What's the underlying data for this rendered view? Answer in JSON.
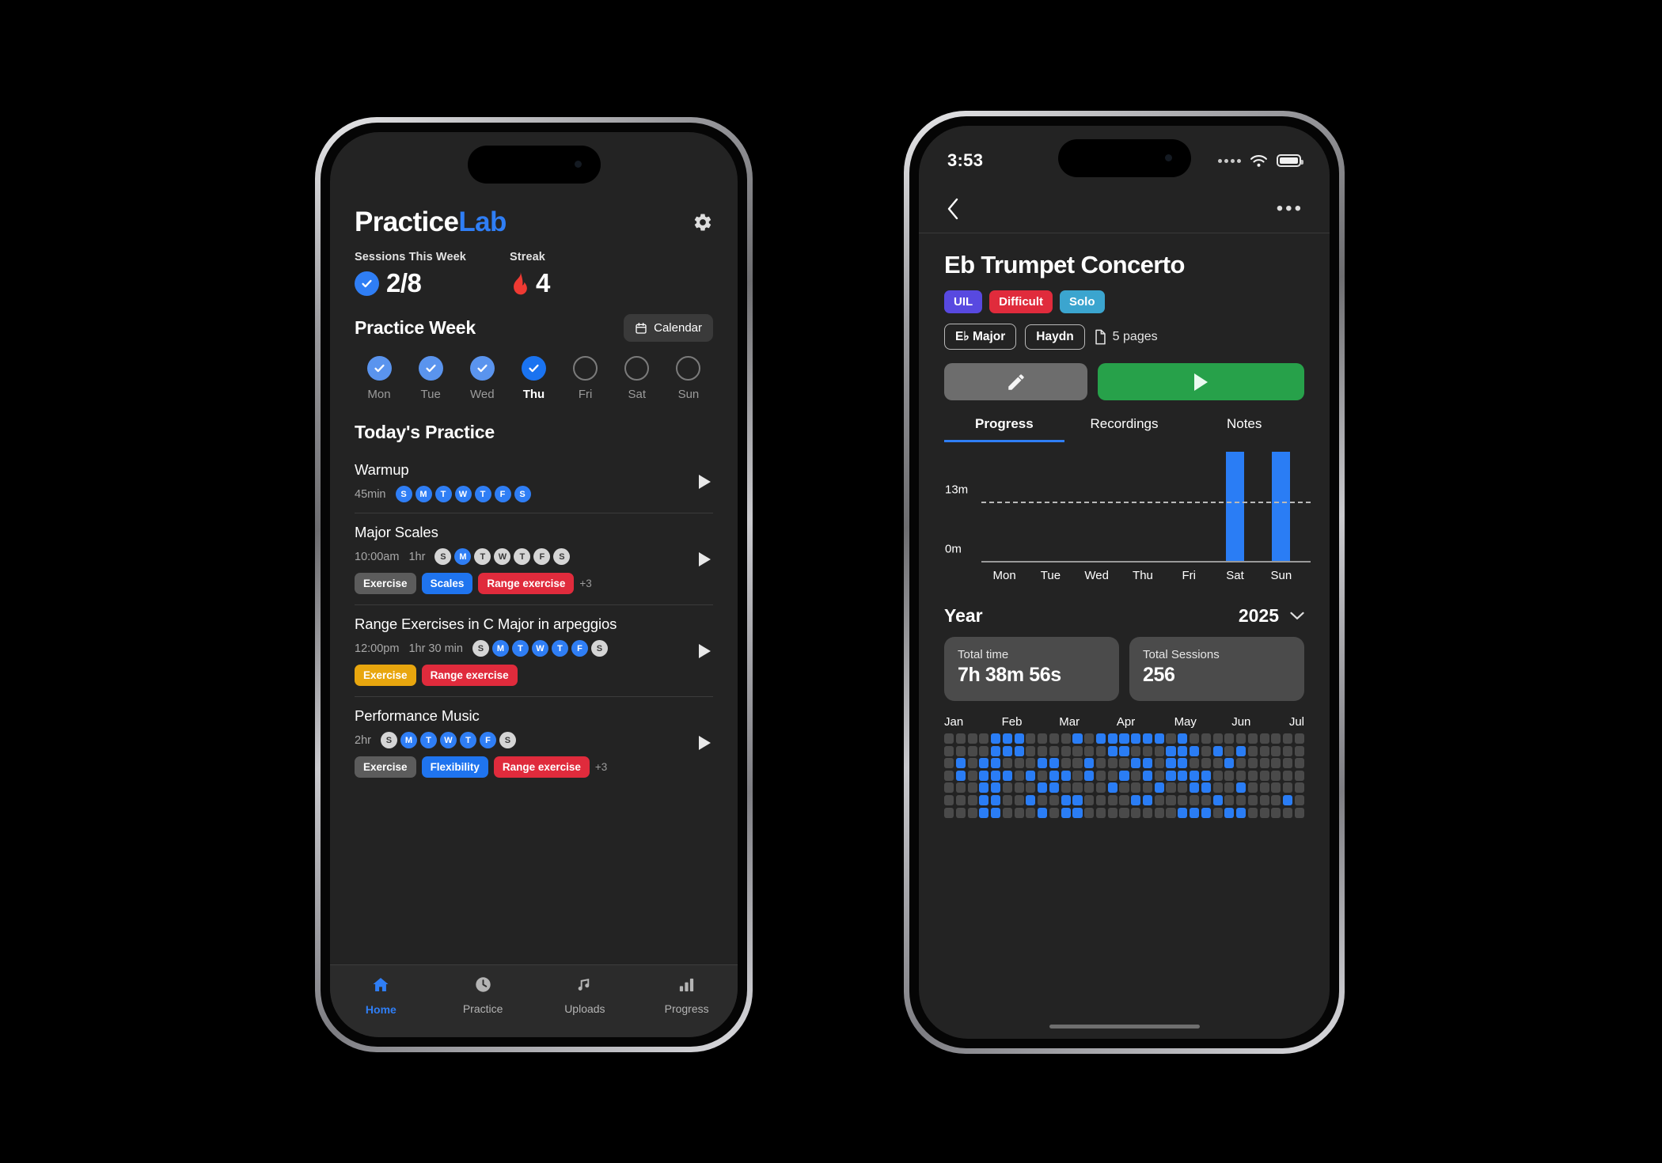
{
  "left_phone": {
    "brand": {
      "part1": "Practice",
      "part2": "Lab"
    },
    "settings_icon": "gear-icon",
    "stats": [
      {
        "label": "Sessions This Week",
        "value": "2/8",
        "icon": "check-circle-icon"
      },
      {
        "label": "Streak",
        "value": "4",
        "icon": "flame-icon"
      }
    ],
    "practice_week": {
      "title": "Practice Week",
      "calendar_button": "Calendar",
      "days": [
        {
          "name": "Mon",
          "state": "done"
        },
        {
          "name": "Tue",
          "state": "done"
        },
        {
          "name": "Wed",
          "state": "done"
        },
        {
          "name": "Thu",
          "state": "today"
        },
        {
          "name": "Fri",
          "state": "empty"
        },
        {
          "name": "Sat",
          "state": "empty"
        },
        {
          "name": "Sun",
          "state": "empty"
        }
      ]
    },
    "today_title": "Today's Practice",
    "tasks": [
      {
        "name": "Warmup",
        "time": "",
        "duration": "45min",
        "days": [
          {
            "letter": "S",
            "on": true
          },
          {
            "letter": "M",
            "on": true
          },
          {
            "letter": "T",
            "on": true
          },
          {
            "letter": "W",
            "on": true
          },
          {
            "letter": "T",
            "on": true
          },
          {
            "letter": "F",
            "on": true
          },
          {
            "letter": "S",
            "on": true
          }
        ],
        "tags": [],
        "more": ""
      },
      {
        "name": "Major Scales",
        "time": "10:00am",
        "duration": "1hr",
        "days": [
          {
            "letter": "S",
            "on": false
          },
          {
            "letter": "M",
            "on": true
          },
          {
            "letter": "T",
            "on": false
          },
          {
            "letter": "W",
            "on": false
          },
          {
            "letter": "T",
            "on": false
          },
          {
            "letter": "F",
            "on": false
          },
          {
            "letter": "S",
            "on": false
          }
        ],
        "tags": [
          {
            "label": "Exercise",
            "color": "#5c5c5c"
          },
          {
            "label": "Scales",
            "color": "#1f74ef"
          },
          {
            "label": "Range exercise",
            "color": "#e02b3c"
          }
        ],
        "more": "+3"
      },
      {
        "name": "Range Exercises in C Major in arpeggios",
        "time": "12:00pm",
        "duration": "1hr 30 min",
        "days": [
          {
            "letter": "S",
            "on": false
          },
          {
            "letter": "M",
            "on": true
          },
          {
            "letter": "T",
            "on": true
          },
          {
            "letter": "W",
            "on": true
          },
          {
            "letter": "T",
            "on": true
          },
          {
            "letter": "F",
            "on": true
          },
          {
            "letter": "S",
            "on": false
          }
        ],
        "tags": [
          {
            "label": "Exercise",
            "color": "#e8a60e"
          },
          {
            "label": "Range exercise",
            "color": "#e02b3c"
          }
        ],
        "more": ""
      },
      {
        "name": "Performance Music",
        "time": "",
        "duration": "2hr",
        "days": [
          {
            "letter": "S",
            "on": false
          },
          {
            "letter": "M",
            "on": true
          },
          {
            "letter": "T",
            "on": true
          },
          {
            "letter": "W",
            "on": true
          },
          {
            "letter": "T",
            "on": true
          },
          {
            "letter": "F",
            "on": true
          },
          {
            "letter": "S",
            "on": false
          }
        ],
        "tags": [
          {
            "label": "Exercise",
            "color": "#5c5c5c"
          },
          {
            "label": "Flexibility",
            "color": "#1f74ef"
          },
          {
            "label": "Range exercise",
            "color": "#e02b3c"
          }
        ],
        "more": "+3"
      }
    ],
    "tabbar": [
      {
        "label": "Home",
        "icon": "home-icon",
        "active": true
      },
      {
        "label": "Practice",
        "icon": "clock-icon",
        "active": false
      },
      {
        "label": "Uploads",
        "icon": "music-note-icon",
        "active": false
      },
      {
        "label": "Progress",
        "icon": "bar-chart-icon",
        "active": false
      }
    ]
  },
  "right_phone": {
    "statusbar": {
      "time": "3:53",
      "wifi_icon": "wifi-icon",
      "battery_icon": "battery-icon",
      "signal_icon": "signal-dots-icon"
    },
    "navbar": {
      "back_icon": "back-chevron-icon",
      "more_icon": "ellipsis-icon"
    },
    "detail": {
      "title": "Eb Trumpet Concerto",
      "badges": [
        {
          "label": "UIL",
          "color": "#5849e0"
        },
        {
          "label": "Difficult",
          "color": "#e02b3c"
        },
        {
          "label": "Solo",
          "color": "#3ba5cf"
        }
      ],
      "chips": [
        "E♭ Major",
        "Haydn"
      ],
      "pages": "5 pages",
      "pages_icon": "document-icon",
      "edit_button_icon": "pencil-icon",
      "play_button_icon": "play-icon"
    },
    "tabs": [
      {
        "label": "Progress",
        "active": true
      },
      {
        "label": "Recordings",
        "active": false
      },
      {
        "label": "Notes",
        "active": false
      }
    ],
    "year_section": {
      "label": "Year",
      "value": "2025",
      "chevron_icon": "chevron-down-icon"
    },
    "cards": [
      {
        "label": "Total time",
        "value": "7h 38m 56s"
      },
      {
        "label": "Total Sessions",
        "value": "256"
      }
    ],
    "heatmap": {
      "months": [
        "Jan",
        "Feb",
        "Mar",
        "Apr",
        "May",
        "Jun",
        "Jul"
      ],
      "rows": 7,
      "cols": 31,
      "on_color": "#2a7df5",
      "off_color": "#4a4a4a",
      "cells": [
        [
          0,
          0,
          0,
          0,
          1,
          1,
          1,
          0,
          0,
          0,
          0,
          1,
          0,
          1,
          1,
          1,
          1,
          1,
          1,
          0,
          1,
          0,
          0,
          0,
          0,
          0,
          0,
          0,
          0,
          0,
          0
        ],
        [
          0,
          0,
          0,
          0,
          1,
          1,
          1,
          0,
          0,
          0,
          0,
          0,
          0,
          0,
          1,
          1,
          0,
          0,
          0,
          1,
          1,
          1,
          0,
          1,
          0,
          1,
          0,
          0,
          0,
          0,
          0
        ],
        [
          0,
          1,
          0,
          1,
          1,
          0,
          0,
          0,
          1,
          1,
          0,
          0,
          1,
          0,
          0,
          0,
          1,
          1,
          0,
          1,
          1,
          0,
          0,
          0,
          1,
          0,
          0,
          0,
          0,
          0,
          0
        ],
        [
          0,
          1,
          0,
          1,
          1,
          1,
          0,
          1,
          0,
          1,
          1,
          0,
          1,
          0,
          0,
          1,
          0,
          1,
          0,
          1,
          1,
          1,
          1,
          0,
          0,
          0,
          0,
          0,
          0,
          0,
          0
        ],
        [
          0,
          0,
          0,
          1,
          1,
          0,
          0,
          0,
          1,
          1,
          0,
          0,
          0,
          0,
          1,
          0,
          0,
          0,
          1,
          0,
          0,
          1,
          1,
          0,
          0,
          1,
          0,
          0,
          0,
          0,
          0
        ],
        [
          0,
          0,
          0,
          1,
          1,
          0,
          0,
          1,
          0,
          0,
          1,
          1,
          0,
          0,
          0,
          0,
          1,
          1,
          0,
          0,
          0,
          0,
          0,
          1,
          0,
          0,
          0,
          0,
          0,
          1,
          0
        ],
        [
          0,
          0,
          0,
          1,
          1,
          0,
          0,
          0,
          1,
          0,
          1,
          1,
          0,
          0,
          0,
          0,
          0,
          0,
          0,
          0,
          1,
          1,
          1,
          0,
          1,
          1,
          0,
          0,
          0,
          0,
          0
        ]
      ]
    },
    "chart_data": {
      "type": "bar",
      "title": "",
      "categories": [
        "Mon",
        "Tue",
        "Wed",
        "Thu",
        "Fri",
        "Sat",
        "Sun"
      ],
      "values": [
        0,
        0,
        0,
        0,
        0,
        24,
        24
      ],
      "xlabel": "",
      "ylabel": "",
      "ylim": [
        0,
        26
      ],
      "yticks": [
        0,
        13
      ],
      "ytick_labels": [
        "0m",
        "13m"
      ],
      "gridline_at": 13,
      "grid": true,
      "bar_color": "#2a7df5",
      "legend": "none"
    }
  }
}
